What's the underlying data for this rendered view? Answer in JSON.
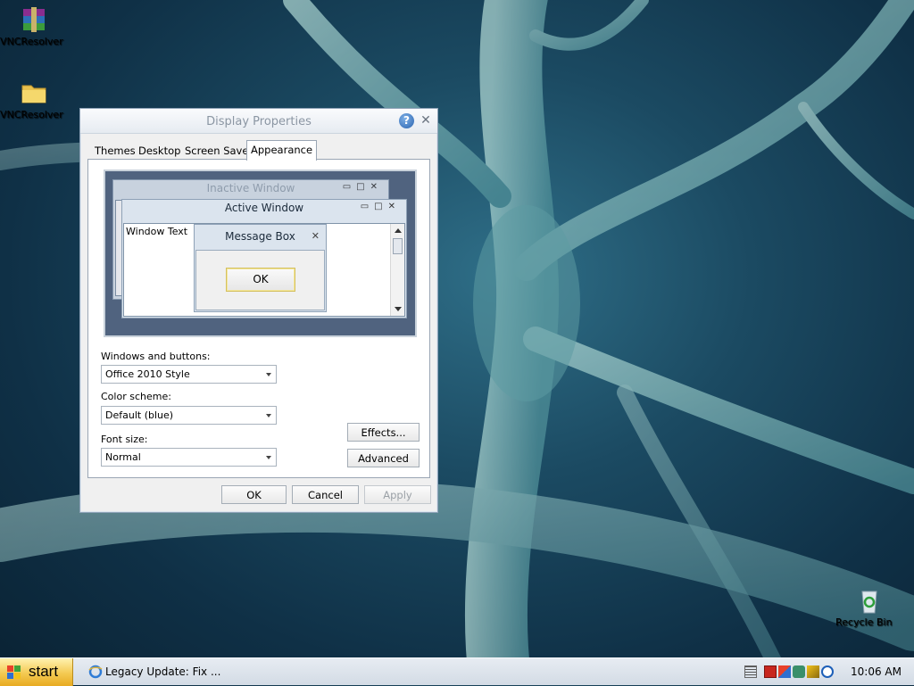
{
  "desktop_icons": [
    {
      "label": "VNCResolver",
      "icon": "winrar-archive-icon"
    },
    {
      "label": "VNCResolver",
      "icon": "folder-icon"
    },
    {
      "label": "Recycle Bin",
      "icon": "recycle-bin-icon"
    }
  ],
  "dialog": {
    "title": "Display Properties",
    "tabs": [
      {
        "label": "Themes"
      },
      {
        "label": "Desktop"
      },
      {
        "label": "Screen Saver"
      },
      {
        "label": "Appearance"
      }
    ],
    "active_tab": "Appearance",
    "preview": {
      "inactive_title": "Inactive Window",
      "active_title": "Active Window",
      "window_text": "Window Text",
      "message_title": "Message Box",
      "ok_label": "OK"
    },
    "windows_buttons": {
      "label": "Windows and buttons:",
      "value": "Office 2010 Style"
    },
    "color_scheme": {
      "label": "Color scheme:",
      "value": "Default (blue)"
    },
    "font_size": {
      "label": "Font size:",
      "value": "Normal"
    },
    "effects_label": "Effects...",
    "advanced_label": "Advanced",
    "ok_label": "OK",
    "cancel_label": "Cancel",
    "apply_label": "Apply"
  },
  "taskbar": {
    "start_label": "start",
    "task_item": "Legacy Update: Fix ...",
    "clock": "10:06 AM"
  }
}
